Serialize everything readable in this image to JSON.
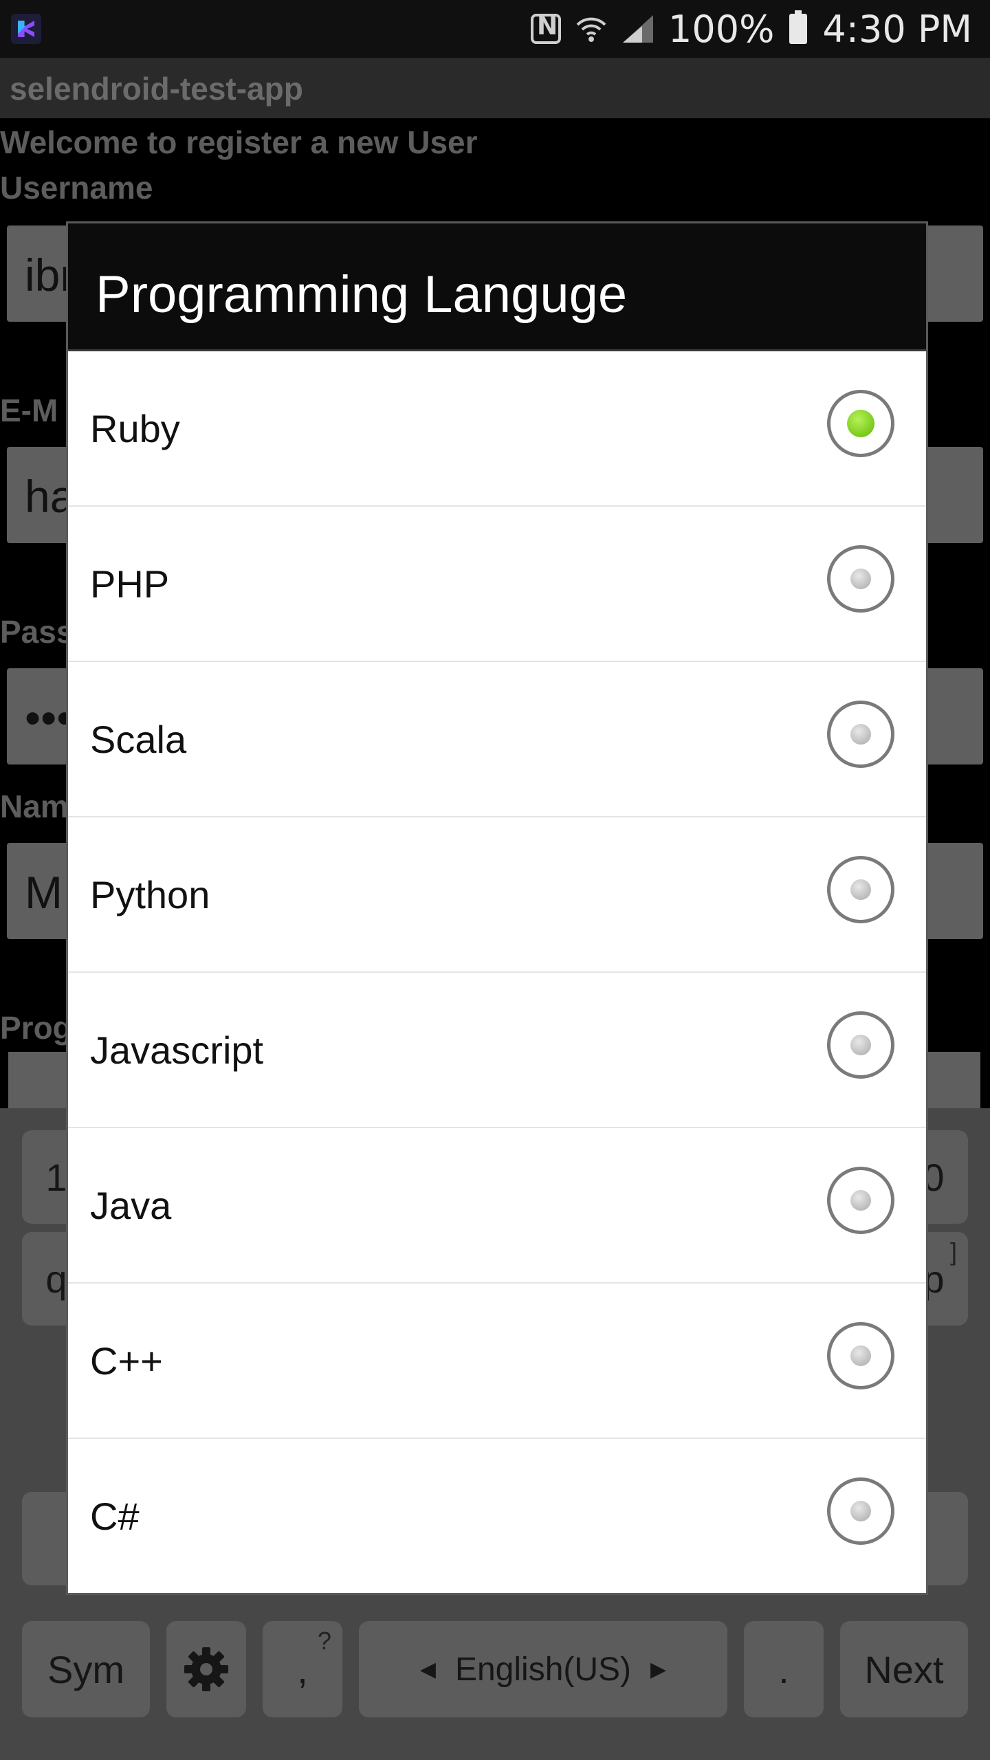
{
  "status_bar": {
    "battery_text": "100%",
    "time": "4:30 PM",
    "icons": [
      "app-notification-icon",
      "nfc-icon",
      "wifi-icon",
      "signal-icon",
      "battery-icon"
    ]
  },
  "app": {
    "title": "selendroid-test-app",
    "welcome_text": "Welcome to register a new User",
    "username_label": "Username",
    "username_value_partial": "ibn",
    "email_label_partial": "E-M",
    "email_value_partial": "ha",
    "password_label_partial": "Pass",
    "password_value_partial": "•••",
    "name_label_partial": "Nam",
    "name_value_partial": "M",
    "programming_label_partial": "Prog"
  },
  "dialog": {
    "title": "Programming Languge",
    "options": [
      {
        "label": "Ruby",
        "checked": true
      },
      {
        "label": "PHP",
        "checked": false
      },
      {
        "label": "Scala",
        "checked": false
      },
      {
        "label": "Python",
        "checked": false
      },
      {
        "label": "Javascript",
        "checked": false
      },
      {
        "label": "Java",
        "checked": false
      },
      {
        "label": "C++",
        "checked": false
      },
      {
        "label": "C#",
        "checked": false
      }
    ],
    "selected_color": "#7ed321"
  },
  "keyboard": {
    "sym_label": "Sym",
    "comma_label": ",",
    "comma_hint": "?",
    "language_label": "English(US)",
    "period_label": ".",
    "next_label": "Next",
    "partial_keys": [
      "1",
      "0",
      "q",
      "p",
      "]"
    ]
  }
}
